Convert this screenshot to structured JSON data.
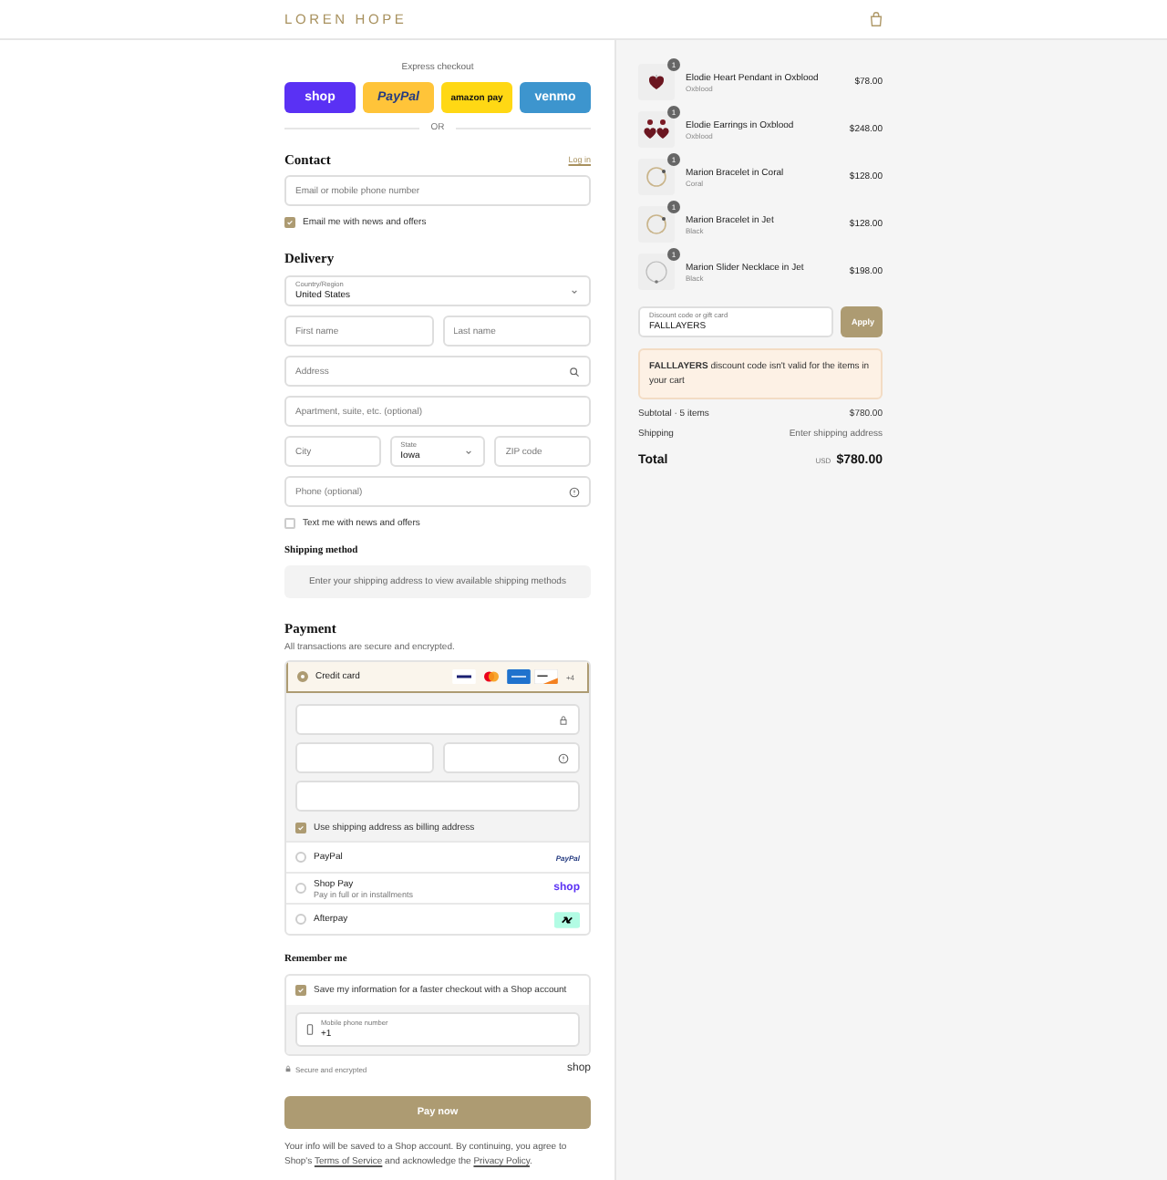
{
  "header": {
    "logo": "LOREN HOPE"
  },
  "express": {
    "title": "Express checkout",
    "buttons": [
      {
        "kind": "shop",
        "label": "shop"
      },
      {
        "kind": "paypal",
        "label": "PayPal"
      },
      {
        "kind": "amazon",
        "label": "amazon pay"
      },
      {
        "kind": "venmo",
        "label": "venmo"
      }
    ],
    "divider": "OR"
  },
  "contact": {
    "title": "Contact",
    "login": "Log in",
    "field": {
      "placeholder": "Email or mobile phone number"
    },
    "news": {
      "label": "Email me with news and offers",
      "checked": true
    }
  },
  "delivery": {
    "title": "Delivery",
    "rows": [
      [
        {
          "kind": "select",
          "label": "Country/Region",
          "value": "United States"
        }
      ],
      [
        {
          "kind": "text",
          "placeholder": "First name"
        },
        {
          "kind": "text",
          "placeholder": "Last name"
        }
      ],
      [
        {
          "kind": "search",
          "placeholder": "Address"
        }
      ],
      [
        {
          "kind": "text",
          "placeholder": "Apartment, suite, etc. (optional)"
        }
      ],
      [
        {
          "kind": "text",
          "placeholder": "City"
        },
        {
          "kind": "select",
          "label": "State",
          "value": "Iowa"
        },
        {
          "kind": "text",
          "placeholder": "ZIP code"
        }
      ],
      [
        {
          "kind": "help",
          "placeholder": "Phone (optional)"
        }
      ]
    ],
    "text_news": {
      "label": "Text me with news and offers",
      "checked": false
    }
  },
  "shipping": {
    "title": "Shipping method",
    "message": "Enter your shipping address to view available shipping methods"
  },
  "payment": {
    "title": "Payment",
    "subtitle": "All transactions are secure and encrypted.",
    "more_cards": "+4",
    "card_rows": [
      [
        {
          "kind": "lock"
        }
      ],
      [
        {
          "kind": "text"
        },
        {
          "kind": "help"
        }
      ],
      [
        {
          "kind": "text"
        }
      ]
    ],
    "billing": {
      "label": "Use shipping address as billing address",
      "checked": true
    },
    "methods": [
      {
        "kind": "card",
        "label": "Credit card",
        "selected": true
      },
      {
        "kind": "paypal",
        "label": "PayPal",
        "logo": "PayPal",
        "selected": false
      },
      {
        "kind": "shoppay",
        "label": "Shop Pay",
        "sublabel": "Pay in full or in installments",
        "logo": "shop",
        "selected": false
      },
      {
        "kind": "afterpay",
        "label": "Afterpay",
        "selected": false
      }
    ]
  },
  "remember": {
    "title": "Remember me",
    "save": {
      "label": "Save my information for a faster checkout with a Shop account",
      "checked": true
    },
    "phone": {
      "label": "Mobile phone number",
      "value": "+1"
    },
    "secure": "Secure and encrypted",
    "shop_logo": "shop"
  },
  "pay_button": "Pay now",
  "consent": {
    "text_1": "Your info will be saved to a Shop account. By continuing, you agree to Shop's",
    "terms": "Terms of Service",
    "text_2": "and acknowledge the",
    "privacy": "Privacy Policy",
    "end": "."
  },
  "cart": {
    "items": [
      {
        "kind": "pendant",
        "quantity": "1",
        "name": "Elodie Heart Pendant in Oxblood",
        "variant": "Oxblood",
        "price": "$78.00"
      },
      {
        "kind": "earrings",
        "quantity": "1",
        "name": "Elodie Earrings in Oxblood",
        "variant": "Oxblood",
        "price": "$248.00"
      },
      {
        "kind": "bracelet",
        "quantity": "1",
        "name": "Marion Bracelet in Coral",
        "variant": "Coral",
        "price": "$128.00"
      },
      {
        "kind": "bracelet",
        "quantity": "1",
        "name": "Marion Bracelet in Jet",
        "variant": "Black",
        "price": "$128.00"
      },
      {
        "kind": "necklace",
        "quantity": "1",
        "name": "Marion Slider Necklace in Jet",
        "variant": "Black",
        "price": "$198.00"
      }
    ],
    "discount": {
      "label": "Discount code or gift card",
      "value": "FALLLAYERS",
      "button": "Apply"
    },
    "error": "**FALLLAYERS** discount code isn't valid for the items in your cart",
    "subtotal": {
      "label": "Subtotal · 5 items",
      "value": "$780.00"
    },
    "shipping": {
      "label": "Shipping",
      "value": "Enter shipping address"
    },
    "total": {
      "label": "Total",
      "currency": "USD",
      "value": "$780.00"
    }
  }
}
